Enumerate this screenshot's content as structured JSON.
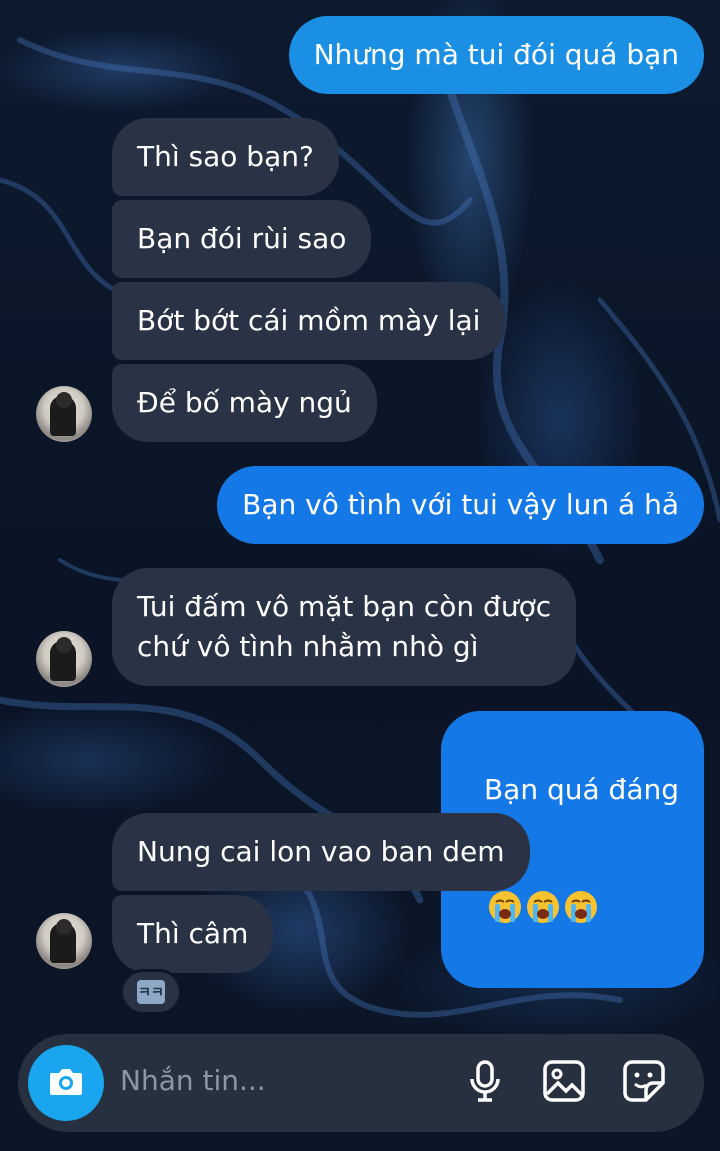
{
  "messages": [
    {
      "side": "out",
      "text": "Nhưng mà tui đói quá bạn"
    },
    {
      "side": "in",
      "text": "Thì sao bạn?"
    },
    {
      "side": "in",
      "text": "Bạn đói rùi sao"
    },
    {
      "side": "in",
      "text": "Bớt bớt cái mồm mày lại"
    },
    {
      "side": "in",
      "text": "Để bố mày ngủ"
    },
    {
      "side": "out",
      "text": "Bạn vô tình với tui vậy lun á hả"
    },
    {
      "side": "in",
      "text": "Tui đấm vô mặt bạn còn được\nchứ vô tình nhằm nhò gì"
    },
    {
      "side": "out",
      "text": "Bạn quá đáng",
      "emojis": [
        "loudly-crying-face",
        "loudly-crying-face",
        "loudly-crying-face"
      ]
    },
    {
      "side": "in",
      "text": "Nung cai lon vao ban dem"
    },
    {
      "side": "in",
      "text": "Thì câm"
    }
  ],
  "reaction": {
    "label": "ㅋㅋ"
  },
  "composer": {
    "placeholder": "Nhắn tin..."
  },
  "colors": {
    "outgoing": "#1b8fe3",
    "incoming": "#2a3346",
    "camera": "#1aa6ee"
  },
  "icons": [
    "camera-icon",
    "microphone-icon",
    "gallery-icon",
    "sticker-icon"
  ]
}
